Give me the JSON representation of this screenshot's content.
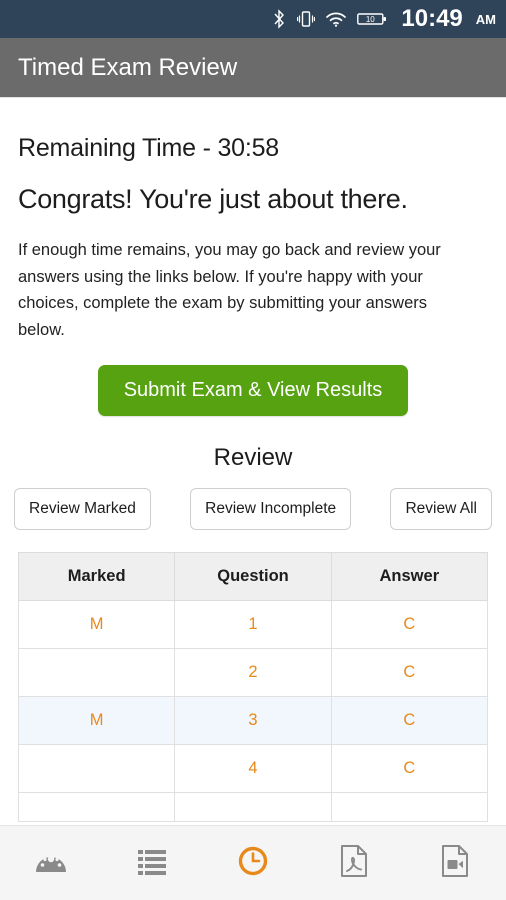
{
  "statusbar": {
    "icons": [
      "bluetooth-icon",
      "vibrate-icon",
      "wifi-icon",
      "battery-icon"
    ],
    "battery_level": "10",
    "time": "10:49",
    "ampm": "AM"
  },
  "header": {
    "title": "Timed Exam Review"
  },
  "main": {
    "remaining_time": "Remaining Time - 30:58",
    "congrats": "Congrats! You're just about there.",
    "paragraph": "If enough time remains, you may go back and review your answers using the links below. If you're happy with your choices, complete the exam by submitting your answers below.",
    "submit_label": "Submit Exam & View Results",
    "review_heading": "Review",
    "review_buttons": [
      {
        "label": "Review Marked",
        "name": "review-marked-button"
      },
      {
        "label": "Review Incomplete",
        "name": "review-incomplete-button"
      },
      {
        "label": "Review All",
        "name": "review-all-button"
      }
    ]
  },
  "table": {
    "columns": [
      "Marked",
      "Question",
      "Answer"
    ],
    "rows": [
      {
        "marked": "M",
        "question": "1",
        "answer": "C",
        "highlight": false
      },
      {
        "marked": "",
        "question": "2",
        "answer": "C",
        "highlight": false
      },
      {
        "marked": "M",
        "question": "3",
        "answer": "C",
        "highlight": true
      },
      {
        "marked": "",
        "question": "4",
        "answer": "C",
        "highlight": false
      },
      {
        "marked": "",
        "question": "",
        "answer": "",
        "highlight": false
      }
    ]
  },
  "bottomnav": {
    "items": [
      {
        "name": "nav-dashboard",
        "icon": "gauge-icon",
        "active": false
      },
      {
        "name": "nav-list",
        "icon": "list-icon",
        "active": false
      },
      {
        "name": "nav-timer",
        "icon": "clock-icon",
        "active": true
      },
      {
        "name": "nav-pdf",
        "icon": "pdf-file-icon",
        "active": false
      },
      {
        "name": "nav-video",
        "icon": "video-file-icon",
        "active": false
      }
    ]
  },
  "colors": {
    "statusbar_bg": "#2f4459",
    "titlebar_bg": "#6b6b6b",
    "submit_green": "#56a211",
    "accent_orange": "#e8891c",
    "row_highlight": "#f2f7fd",
    "nav_inactive": "#8a8a8a"
  }
}
